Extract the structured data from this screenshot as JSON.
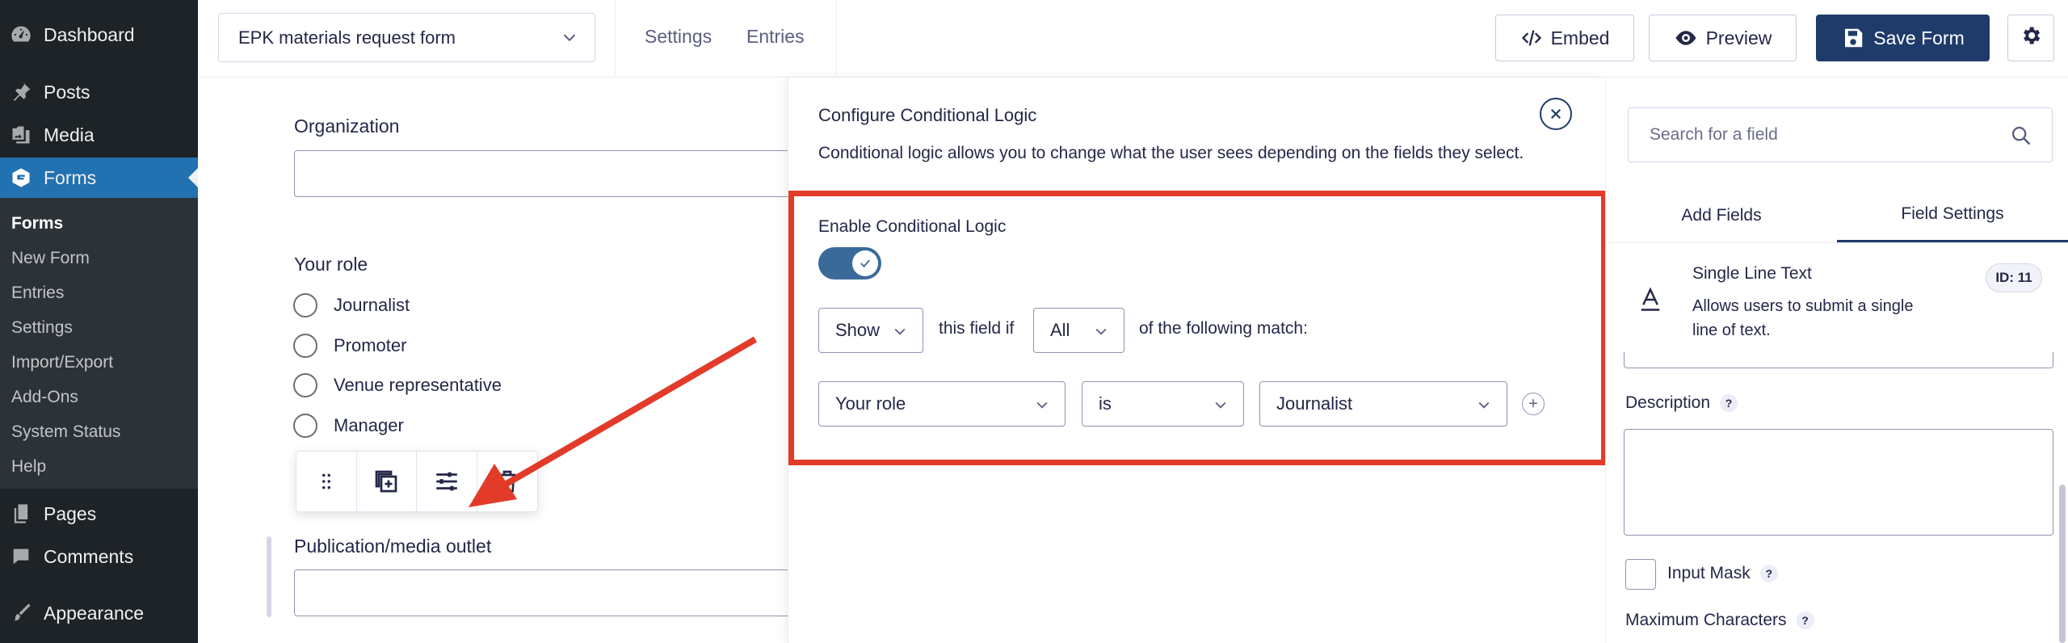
{
  "wp_menu": {
    "dashboard": "Dashboard",
    "posts": "Posts",
    "media": "Media",
    "forms": "Forms",
    "submenu": [
      "Forms",
      "New Form",
      "Entries",
      "Settings",
      "Import/Export",
      "Add-Ons",
      "System Status",
      "Help"
    ],
    "pages": "Pages",
    "comments": "Comments",
    "appearance": "Appearance"
  },
  "topbar": {
    "form_name": "EPK materials request form",
    "settings_link": "Settings",
    "entries_link": "Entries",
    "embed_label": "Embed",
    "preview_label": "Preview",
    "save_label": "Save Form"
  },
  "canvas": {
    "organization_label": "Organization",
    "role_label": "Your role",
    "role_options": [
      "Journalist",
      "Promoter",
      "Venue representative",
      "Manager"
    ],
    "publication_label": "Publication/media outlet"
  },
  "conditional_logic": {
    "title": "Configure Conditional Logic",
    "description": "Conditional logic allows you to change what the user sees depending on the fields they select.",
    "enable_label": "Enable Conditional Logic",
    "enabled": true,
    "action": "Show",
    "this_field_if": "this field if",
    "match_type": "All",
    "of_following": "of the following match:",
    "rule": {
      "field": "Your role",
      "operator": "is",
      "value": "Journalist"
    },
    "add_rule": "+"
  },
  "right_panel": {
    "search_placeholder": "Search for a field",
    "tab_add_fields": "Add Fields",
    "tab_field_settings": "Field Settings",
    "field_type_title": "Single Line Text",
    "field_type_desc": "Allows users to submit a single line of text.",
    "field_id": "ID: 11",
    "description_label": "Description",
    "input_mask_label": "Input Mask",
    "max_chars_label": "Maximum Characters",
    "help": "?"
  },
  "colors": {
    "wp_sidebar": "#1d2327",
    "wp_active": "#2271b1",
    "primary": "#1e3b6a",
    "highlight": "#e23b2a",
    "toggle_on": "#3a6a9a"
  }
}
